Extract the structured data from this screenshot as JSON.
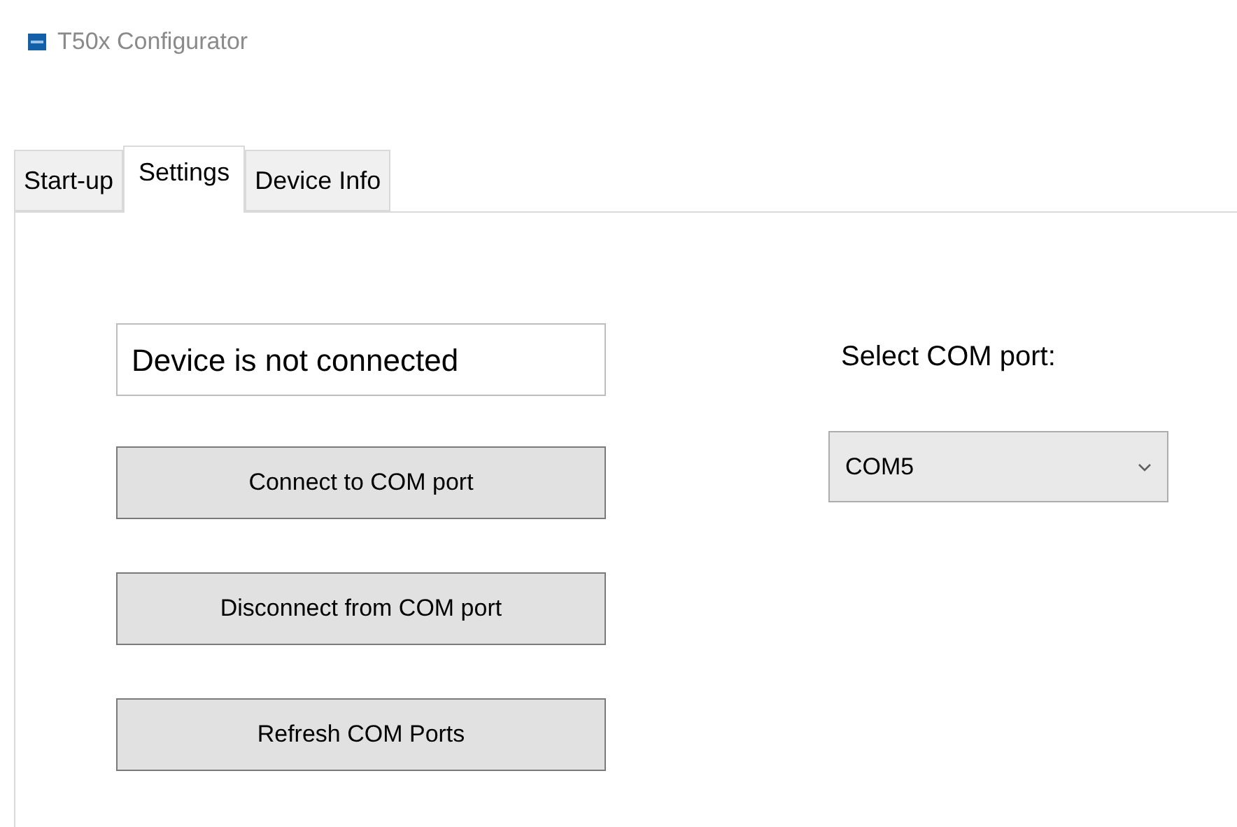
{
  "window": {
    "title": "T50x Configurator"
  },
  "tabs": [
    {
      "label": "Start-up",
      "selected": false
    },
    {
      "label": "Settings",
      "selected": true
    },
    {
      "label": "Device Info",
      "selected": false
    }
  ],
  "status_field": {
    "value": "Device is not connected"
  },
  "buttons": [
    "Connect to COM port",
    "Disconnect from COM port",
    "Refresh COM Ports"
  ],
  "com_port": {
    "label": "Select COM port:",
    "value": "COM5"
  }
}
